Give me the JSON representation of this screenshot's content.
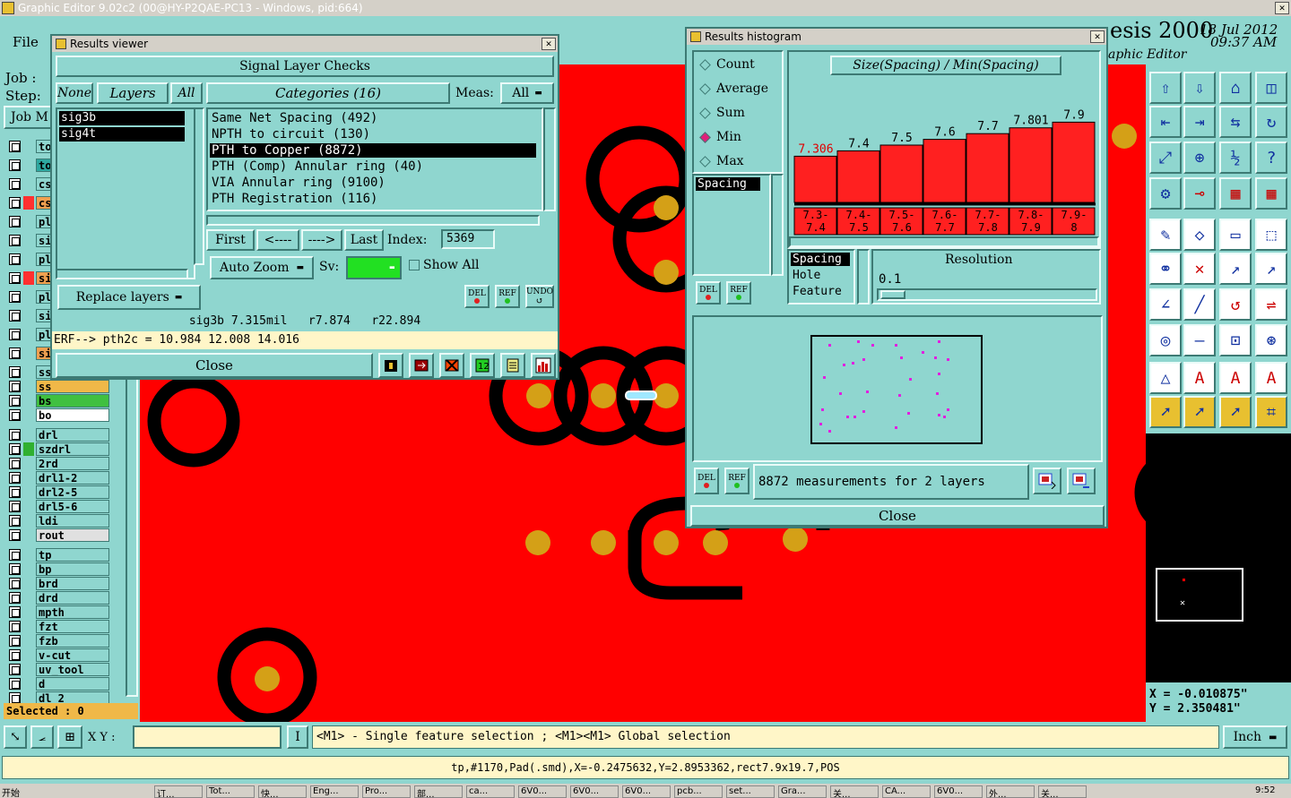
{
  "app": {
    "title": "Graphic Editor 9.02c2 (00@HY-P2QAE-PC13 - Windows, pid:664)",
    "menu_file": "File",
    "job_label": "Job :",
    "step_label": "Step:",
    "job_button": "Job M",
    "brand": "esis 2000",
    "brand_sub": "aphic Editor",
    "date": "18 Jul 2012",
    "time": "09:37 AM",
    "selected": "Selected : 0",
    "xy_label": "X Y :",
    "xy_value": "",
    "hint": "<M1> - Single feature selection ; <M1><M1> Global selection",
    "units": "Inch",
    "status_line": "tp,#1170,Pad(.smd),X=-0.2475632,Y=2.8953362,rect7.9x19.7,POS",
    "coord_x": "X = -0.010875\"",
    "coord_y": "Y = 2.350481\""
  },
  "layers": [
    {
      "name": "to",
      "color": "#8fd6cf"
    },
    {
      "name": "to",
      "color": "#2ea8a0"
    },
    {
      "name": "cs",
      "color": "#8fd6cf"
    },
    {
      "name": "cs",
      "color": "#f0a050"
    },
    {
      "name": "pl",
      "color": "#8fd6cf"
    },
    {
      "name": "si",
      "color": "#8fd6cf"
    },
    {
      "name": "pl",
      "color": "#8fd6cf"
    },
    {
      "name": "si",
      "color": "#f0a050"
    },
    {
      "name": "pl",
      "color": "#8fd6cf"
    },
    {
      "name": "si",
      "color": "#8fd6cf"
    },
    {
      "name": "pl",
      "color": "#8fd6cf"
    },
    {
      "name": "si",
      "color": "#f0a050"
    },
    {
      "name": "ss",
      "color": "#8fd6cf"
    },
    {
      "name": "ss",
      "color": "#f0b848"
    },
    {
      "name": "bs",
      "color": "#40c040"
    },
    {
      "name": "bo",
      "color": "#ffffff"
    },
    {
      "name": "drl",
      "color": "#8fd6cf"
    },
    {
      "name": "szdrl",
      "color": "#8fd6cf"
    },
    {
      "name": "2rd",
      "color": "#8fd6cf"
    },
    {
      "name": "drl1-2",
      "color": "#8fd6cf"
    },
    {
      "name": "drl2-5",
      "color": "#8fd6cf"
    },
    {
      "name": "drl5-6",
      "color": "#8fd6cf"
    },
    {
      "name": "ldi",
      "color": "#8fd6cf"
    },
    {
      "name": "rout",
      "color": "#e0e0e0"
    },
    {
      "name": "tp",
      "color": "#8fd6cf"
    },
    {
      "name": "bp",
      "color": "#8fd6cf"
    },
    {
      "name": "brd",
      "color": "#8fd6cf"
    },
    {
      "name": "drd",
      "color": "#8fd6cf"
    },
    {
      "name": "mpth",
      "color": "#8fd6cf"
    },
    {
      "name": "fzt",
      "color": "#8fd6cf"
    },
    {
      "name": "fzb",
      "color": "#8fd6cf"
    },
    {
      "name": "v-cut",
      "color": "#8fd6cf"
    },
    {
      "name": "uv_tool",
      "color": "#8fd6cf"
    },
    {
      "name": "d",
      "color": "#8fd6cf"
    },
    {
      "name": "dl 2",
      "color": "#8fd6cf"
    }
  ],
  "results_viewer": {
    "title": "Results viewer",
    "header": "Signal Layer Checks",
    "tab_none": "None",
    "tab_layers": "Layers",
    "tab_all": "All",
    "layer_list": [
      "sig3b",
      "sig4t"
    ],
    "categories_label": "Categories (16)",
    "meas_label": "Meas:",
    "meas_value": "All",
    "categories": [
      "Same Net Spacing (492)",
      "NPTH to circuit (130)",
      "PTH to Copper (8872)",
      "PTH (Comp) Annular ring (40)",
      "VIA Annular ring (9100)",
      "PTH Registration (116)"
    ],
    "selected_category": 2,
    "first": "First",
    "prev": "<----",
    "next": "---->",
    "last": "Last",
    "index_label": "Index:",
    "index_value": "5369",
    "auto_zoom": "Auto Zoom",
    "sv_label": "Sv:",
    "show_all": "Show All",
    "replace_layers": "Replace layers",
    "del": "DEL",
    "ref": "REF",
    "undo": "UNDO",
    "info": "sig3b 7.315mil   r7.874   r22.894",
    "erf": "ERF--> pth2c = 10.984 12.008 14.016",
    "close": "Close"
  },
  "histogram": {
    "title": "Results histogram",
    "modes": [
      "Count",
      "Average",
      "Sum",
      "Min",
      "Max"
    ],
    "selected_mode": 3,
    "list_left": [
      "Spacing"
    ],
    "heading": "Size(Spacing) / Min(Spacing)",
    "list_right": [
      "Spacing",
      "Hole",
      "Feature"
    ],
    "resolution_label": "Resolution",
    "resolution_value": "0.1",
    "summary": "8872 measurements for 2 layers",
    "del": "DEL",
    "ref": "REF",
    "close": "Close"
  },
  "chart_data": {
    "type": "bar",
    "title": "Size(Spacing) / Min(Spacing)",
    "categories": [
      "7.3-7.4",
      "7.4-7.5",
      "7.5-7.6",
      "7.6-7.7",
      "7.7-7.8",
      "7.8-7.9",
      "7.9-8"
    ],
    "top_labels": [
      "7.306",
      "7.4",
      "7.5",
      "7.6",
      "7.7",
      "7.801",
      "7.9"
    ],
    "values": [
      7.306,
      7.4,
      7.5,
      7.6,
      7.7,
      7.801,
      7.9
    ],
    "ylim": [
      6.5,
      8.0
    ],
    "bar_color": "#ff2020"
  },
  "taskbar": {
    "start": "开始",
    "clock": "9:52",
    "items": [
      "订...",
      "Tot...",
      "快...",
      "Eng...",
      "Pro...",
      "部...",
      "ca...",
      "6V0...",
      "6V0...",
      "6V0...",
      "pcb...",
      "set...",
      "Gra...",
      "关...",
      "CA...",
      "6V0...",
      "外...",
      "关..."
    ]
  },
  "colors": {
    "canvas": "#ff0000",
    "teal": "#8fd6cf",
    "pad": "#d4a017",
    "copper_ring": "#000000"
  }
}
